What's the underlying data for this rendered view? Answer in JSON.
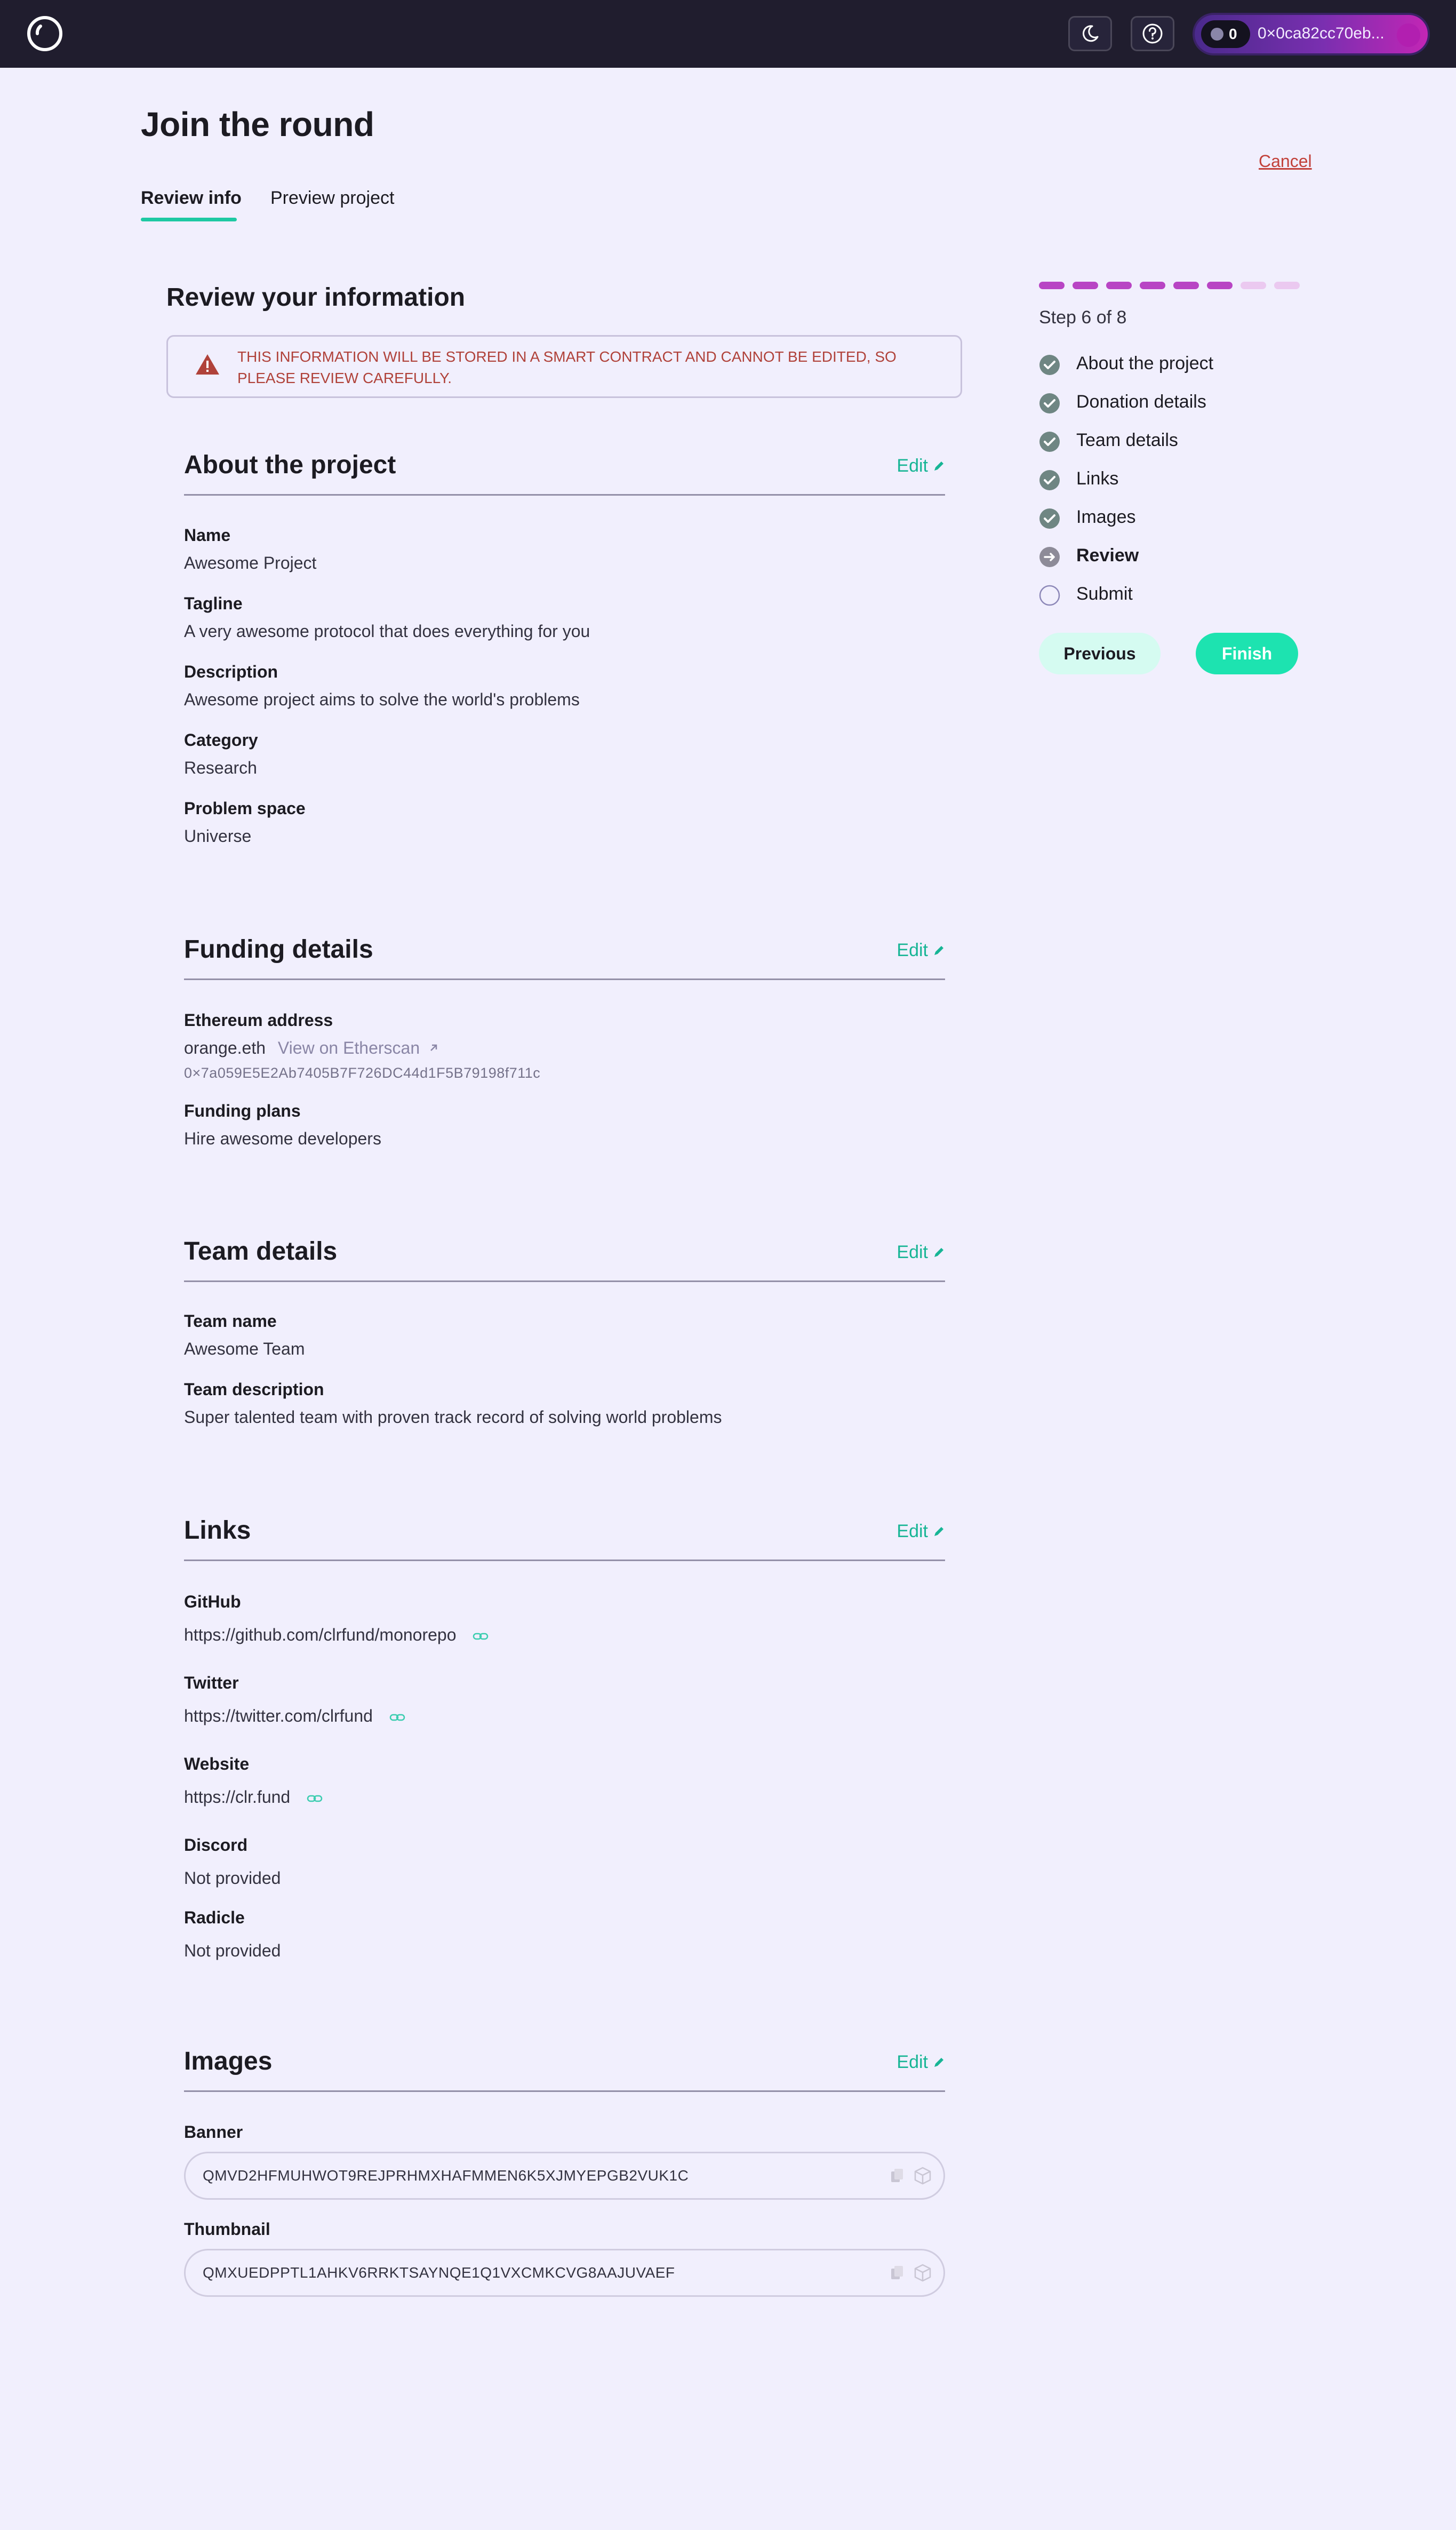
{
  "header": {
    "logo_icon": "clr-fund-logo-icon",
    "theme_icon": "moon-icon",
    "help_icon": "question-circle-icon",
    "wallet": {
      "balance": "0",
      "address": "0×0ca82cc70eb..."
    }
  },
  "page": {
    "title": "Join the round",
    "cancel_label": "Cancel",
    "tabs": [
      {
        "label": "Review info",
        "active": true
      },
      {
        "label": "Preview project",
        "active": false
      }
    ]
  },
  "review": {
    "heading": "Review your information",
    "warning": "THIS INFORMATION WILL BE STORED IN A SMART CONTRACT AND CANNOT BE EDITED, SO PLEASE REVIEW CAREFULLY.",
    "edit_label": "Edit",
    "about": {
      "title": "About the project",
      "fields": [
        {
          "label": "Name",
          "value": "Awesome Project"
        },
        {
          "label": "Tagline",
          "value": "A very awesome protocol that does everything for you"
        },
        {
          "label": "Description",
          "value": "Awesome project aims to solve the world's problems"
        },
        {
          "label": "Category",
          "value": "Research"
        },
        {
          "label": "Problem space",
          "value": "Universe"
        }
      ]
    },
    "funding": {
      "title": "Funding details",
      "address_label": "Ethereum address",
      "ens": "orange.eth",
      "etherscan_label": "View on Etherscan",
      "address": "0×7a059E5E2Ab7405B7F726DC44d1F5B79198f711c",
      "plans_label": "Funding plans",
      "plans": "Hire awesome developers"
    },
    "team": {
      "title": "Team details",
      "fields": [
        {
          "label": "Team name",
          "value": "Awesome Team"
        },
        {
          "label": "Team description",
          "value": "Super talented team with proven track record of solving world problems"
        }
      ]
    },
    "links": {
      "title": "Links",
      "items": [
        {
          "label": "GitHub",
          "value": "https://github.com/clrfund/monorepo"
        },
        {
          "label": "Twitter",
          "value": "https://twitter.com/clrfund"
        },
        {
          "label": "Website",
          "value": "https://clr.fund"
        },
        {
          "label": "Discord",
          "value": "Not provided"
        },
        {
          "label": "Radicle",
          "value": "Not provided"
        }
      ]
    },
    "images": {
      "title": "Images",
      "banner_label": "Banner",
      "banner_hash": "QMVD2HFMUHWOT9REJPRHMXHAFMMEN6K5XJMYEPGB2VUK1C",
      "thumbnail_label": "Thumbnail",
      "thumbnail_hash": "QMXUEDPPTL1AHKV6RRKTSAYNQE1Q1VXCMKCVG8AAJUVAEF"
    }
  },
  "sidebar": {
    "progress": {
      "current": 6,
      "total": 8
    },
    "step_label": "Step 6 of 8",
    "steps": [
      {
        "label": "About the project",
        "status": "done"
      },
      {
        "label": "Donation details",
        "status": "done"
      },
      {
        "label": "Team details",
        "status": "done"
      },
      {
        "label": "Links",
        "status": "done"
      },
      {
        "label": "Images",
        "status": "done"
      },
      {
        "label": "Review",
        "status": "current"
      },
      {
        "label": "Submit",
        "status": "todo"
      }
    ],
    "previous_label": "Previous",
    "finish_label": "Finish"
  },
  "colors": {
    "accent": "#1ec9a3",
    "done_step": "#6f8683",
    "progress_done": "#b845c4",
    "progress_todo": "#ebc9f0",
    "warning": "#b0423a"
  }
}
